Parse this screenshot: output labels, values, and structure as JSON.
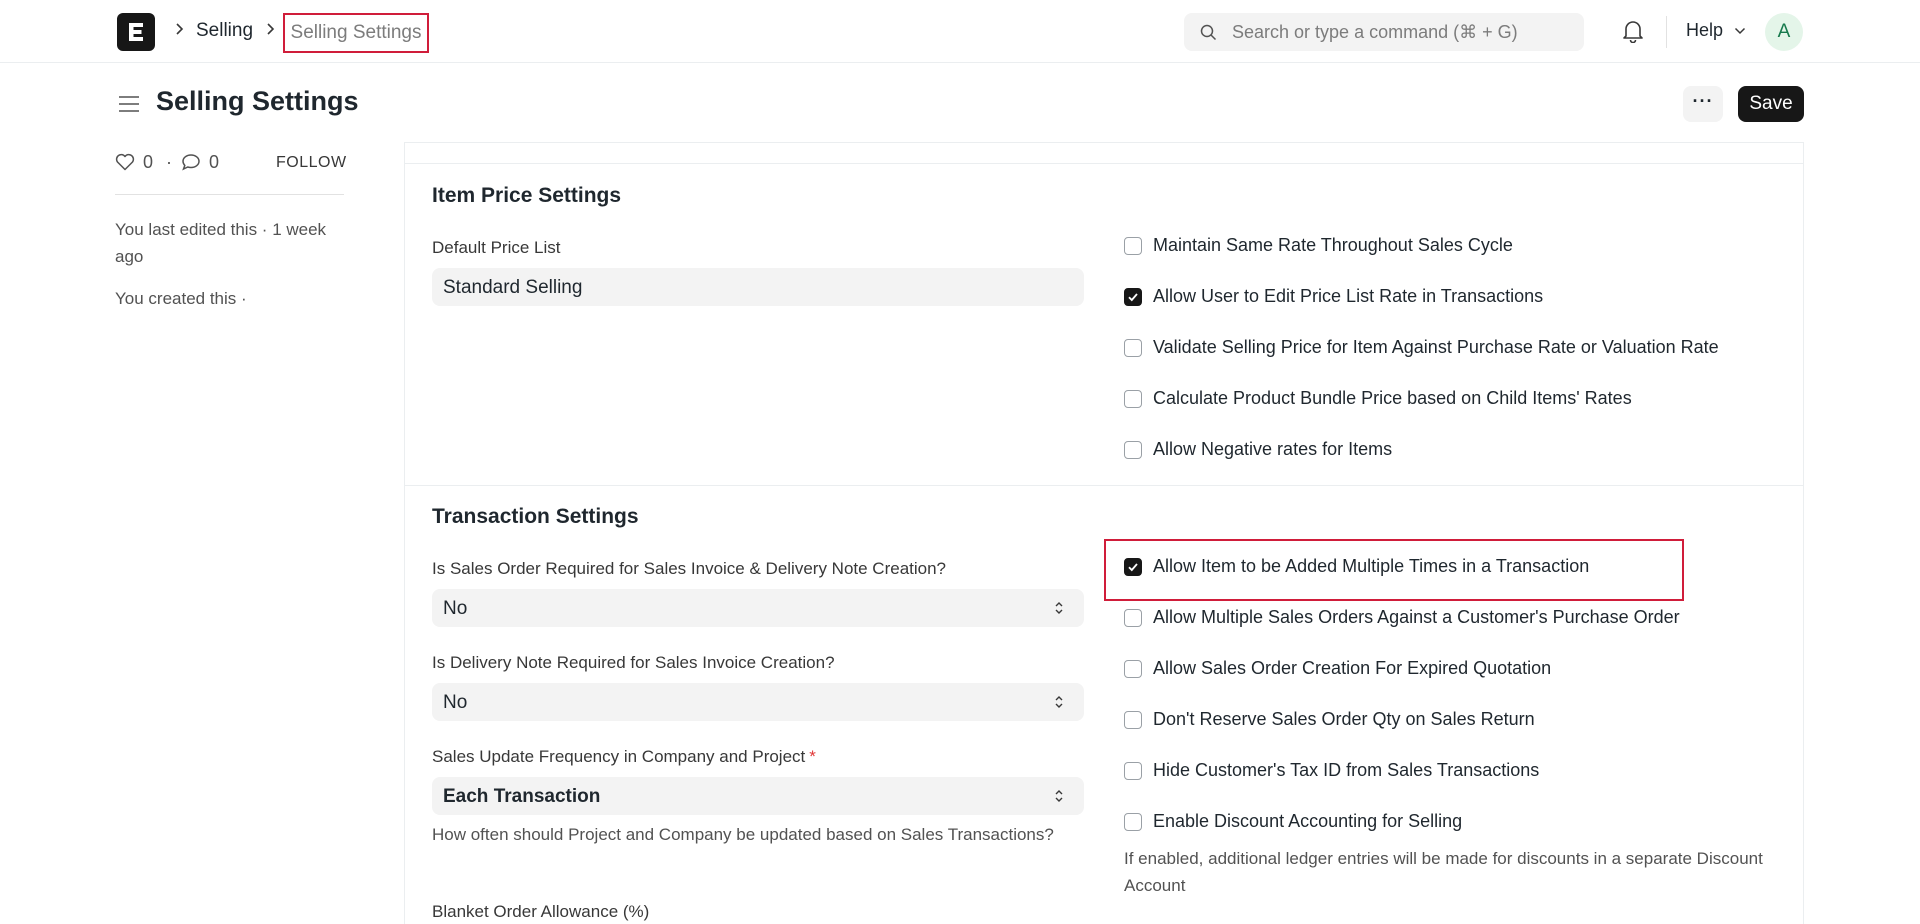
{
  "navbar": {
    "breadcrumb_parent": "Selling",
    "breadcrumb_current": "Selling Settings",
    "search_placeholder": "Search or type a command (⌘ + G)",
    "help_label": "Help",
    "avatar_initial": "A"
  },
  "page": {
    "title": "Selling Settings",
    "more_label": "···",
    "save_label": "Save"
  },
  "sidebar": {
    "likes": "0",
    "separator": "·",
    "comments": "0",
    "follow_label": "FOLLOW",
    "last_edited": "You last edited this · 1 week ago",
    "created": "You created this ·"
  },
  "item_price_settings": {
    "title": "Item Price Settings",
    "default_price_list_label": "Default Price List",
    "default_price_list_value": "Standard Selling",
    "checks": [
      {
        "label": "Maintain Same Rate Throughout Sales Cycle",
        "checked": false
      },
      {
        "label": "Allow User to Edit Price List Rate in Transactions",
        "checked": true
      },
      {
        "label": "Validate Selling Price for Item Against Purchase Rate or Valuation Rate",
        "checked": false
      },
      {
        "label": "Calculate Product Bundle Price based on Child Items' Rates",
        "checked": false
      },
      {
        "label": "Allow Negative rates for Items",
        "checked": false
      }
    ]
  },
  "transaction_settings": {
    "title": "Transaction Settings",
    "so_required_label": "Is Sales Order Required for Sales Invoice & Delivery Note Creation?",
    "so_required_value": "No",
    "dn_required_label": "Is Delivery Note Required for Sales Invoice Creation?",
    "dn_required_value": "No",
    "update_frequency_label": "Sales Update Frequency in Company and Project",
    "update_frequency_required_mark": "*",
    "update_frequency_value": "Each Transaction",
    "update_frequency_desc": "How often should Project and Company be updated based on Sales Transactions?",
    "blanket_order_label": "Blanket Order Allowance (%)",
    "checks": [
      {
        "label": "Allow Item to be Added Multiple Times in a Transaction",
        "checked": true
      },
      {
        "label": "Allow Multiple Sales Orders Against a Customer's Purchase Order",
        "checked": false
      },
      {
        "label": "Allow Sales Order Creation For Expired Quotation",
        "checked": false
      },
      {
        "label": "Don't Reserve Sales Order Qty on Sales Return",
        "checked": false
      },
      {
        "label": "Hide Customer's Tax ID from Sales Transactions",
        "checked": false
      },
      {
        "label": "Enable Discount Accounting for Selling",
        "checked": false
      }
    ],
    "discount_desc": "If enabled, additional ledger entries will be made for discounts in a separate Discount Account"
  },
  "colors": {
    "highlight": "#d01d3a",
    "primary_button": "#171717",
    "avatar_bg": "#e4f5e9",
    "avatar_text": "#16794c"
  }
}
